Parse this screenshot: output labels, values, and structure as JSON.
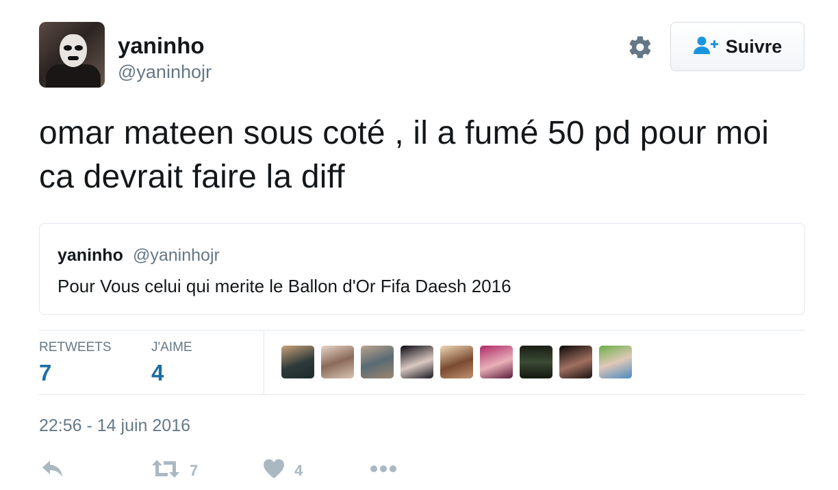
{
  "user": {
    "display_name": "yaninho",
    "handle": "@yaninhojr"
  },
  "follow_button": {
    "label": "Suivre"
  },
  "tweet": {
    "text": "omar mateen sous coté , il a fumé 50 pd pour moi ca devrait faire la diff"
  },
  "quoted_tweet": {
    "display_name": "yaninho",
    "handle": "@yaninhojr",
    "text": "Pour Vous celui qui merite le Ballon d'Or Fifa Daesh 2016"
  },
  "stats": {
    "retweets_label": "RETWEETS",
    "retweets_value": "7",
    "likes_label": "J'AIME",
    "likes_value": "4"
  },
  "timestamp": "22:56 - 14 juin 2016",
  "actions": {
    "retweet_count": "7",
    "like_count": "4"
  },
  "icons": [
    "gear-icon",
    "follow-user-plus-icon",
    "reply-icon",
    "retweet-icon",
    "heart-icon",
    "more-icon"
  ],
  "colors": {
    "accent": "#1b95e0",
    "stat_value": "#1c6ea4",
    "muted": "#657786",
    "action_gray": "#aab8c2"
  }
}
